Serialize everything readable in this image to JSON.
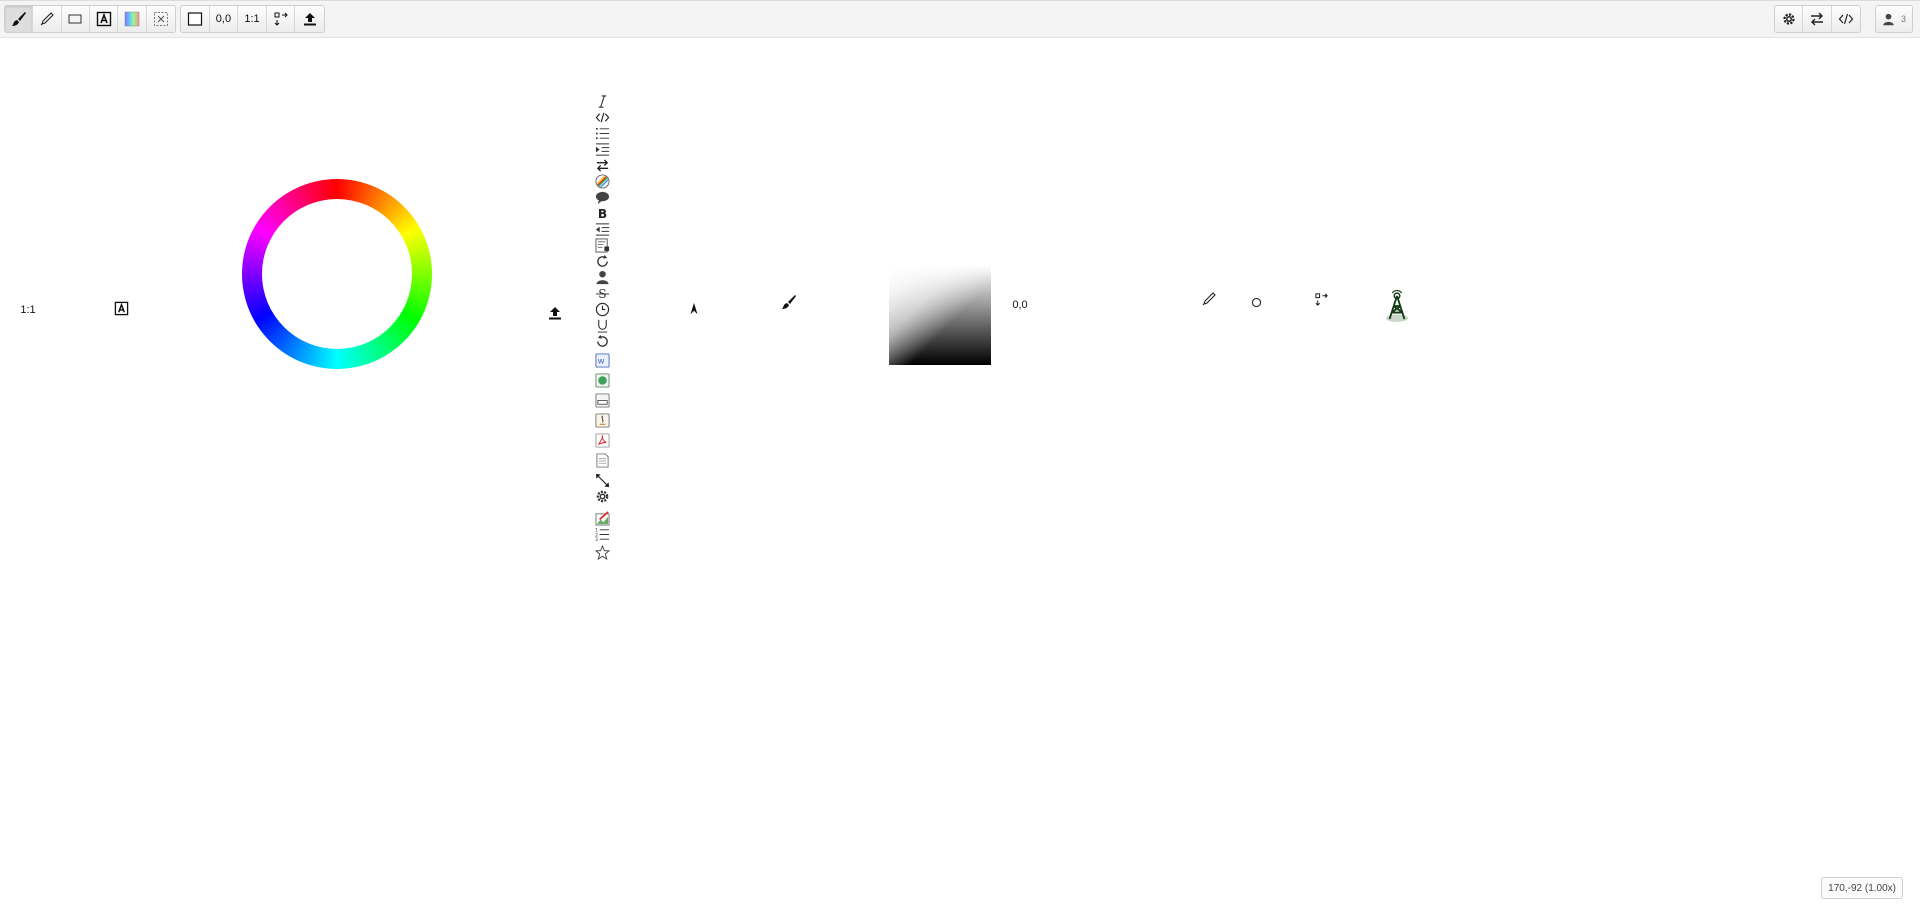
{
  "toolbar": {
    "left_tools": [
      {
        "name": "brush-tool",
        "icon": "brush-icon"
      },
      {
        "name": "pencil-tool",
        "icon": "pencil-icon"
      },
      {
        "name": "rectangle-tool",
        "icon": "rectangle-icon"
      },
      {
        "name": "text-tool",
        "icon": "text-box-icon"
      },
      {
        "name": "palette-tool",
        "icon": "color-swatch-icon"
      },
      {
        "name": "select-tool",
        "icon": "selection-x-icon"
      }
    ],
    "view_tools": {
      "frame_icon": "square-outline-icon",
      "coords_label": "0,0",
      "ratio_label": "1:1",
      "move_icon": "move-arrows-icon",
      "upload_icon": "upload-icon"
    },
    "right_tools": [
      "gear-icon",
      "swap-arrows-icon",
      "code-icon"
    ],
    "user_count": "3"
  },
  "canvas": {
    "ratio_label": "1:1",
    "coords_label": "0,0",
    "floating_icons": [
      "text-box-icon",
      "upload-icon",
      "cursor-icon",
      "brush-icon",
      "pencil-icon",
      "circle-icon",
      "move-arrows-icon",
      "tower-icon"
    ],
    "icon_column": [
      "italic-icon",
      "code-icon",
      "bulleted-list-icon",
      "indent-icon",
      "swap-arrows-icon",
      "palette-icon",
      "speech-bubble-icon",
      "bold-icon",
      "outdent-icon",
      "document-lock-icon",
      "redo-icon",
      "user-icon",
      "strikethrough-icon",
      "clock-icon",
      "underline-icon",
      "undo-icon",
      "word-doc-icon",
      "web-doc-icon",
      "image-doc-icon",
      "java-doc-icon",
      "pdf-doc-icon",
      "blank-doc-icon",
      "resize-diagonal-icon",
      "gear-icon",
      "edit-image-icon",
      "numbered-list-icon",
      "star-icon"
    ]
  },
  "status_bar": {
    "text": "170,-92 (1.00x)"
  }
}
